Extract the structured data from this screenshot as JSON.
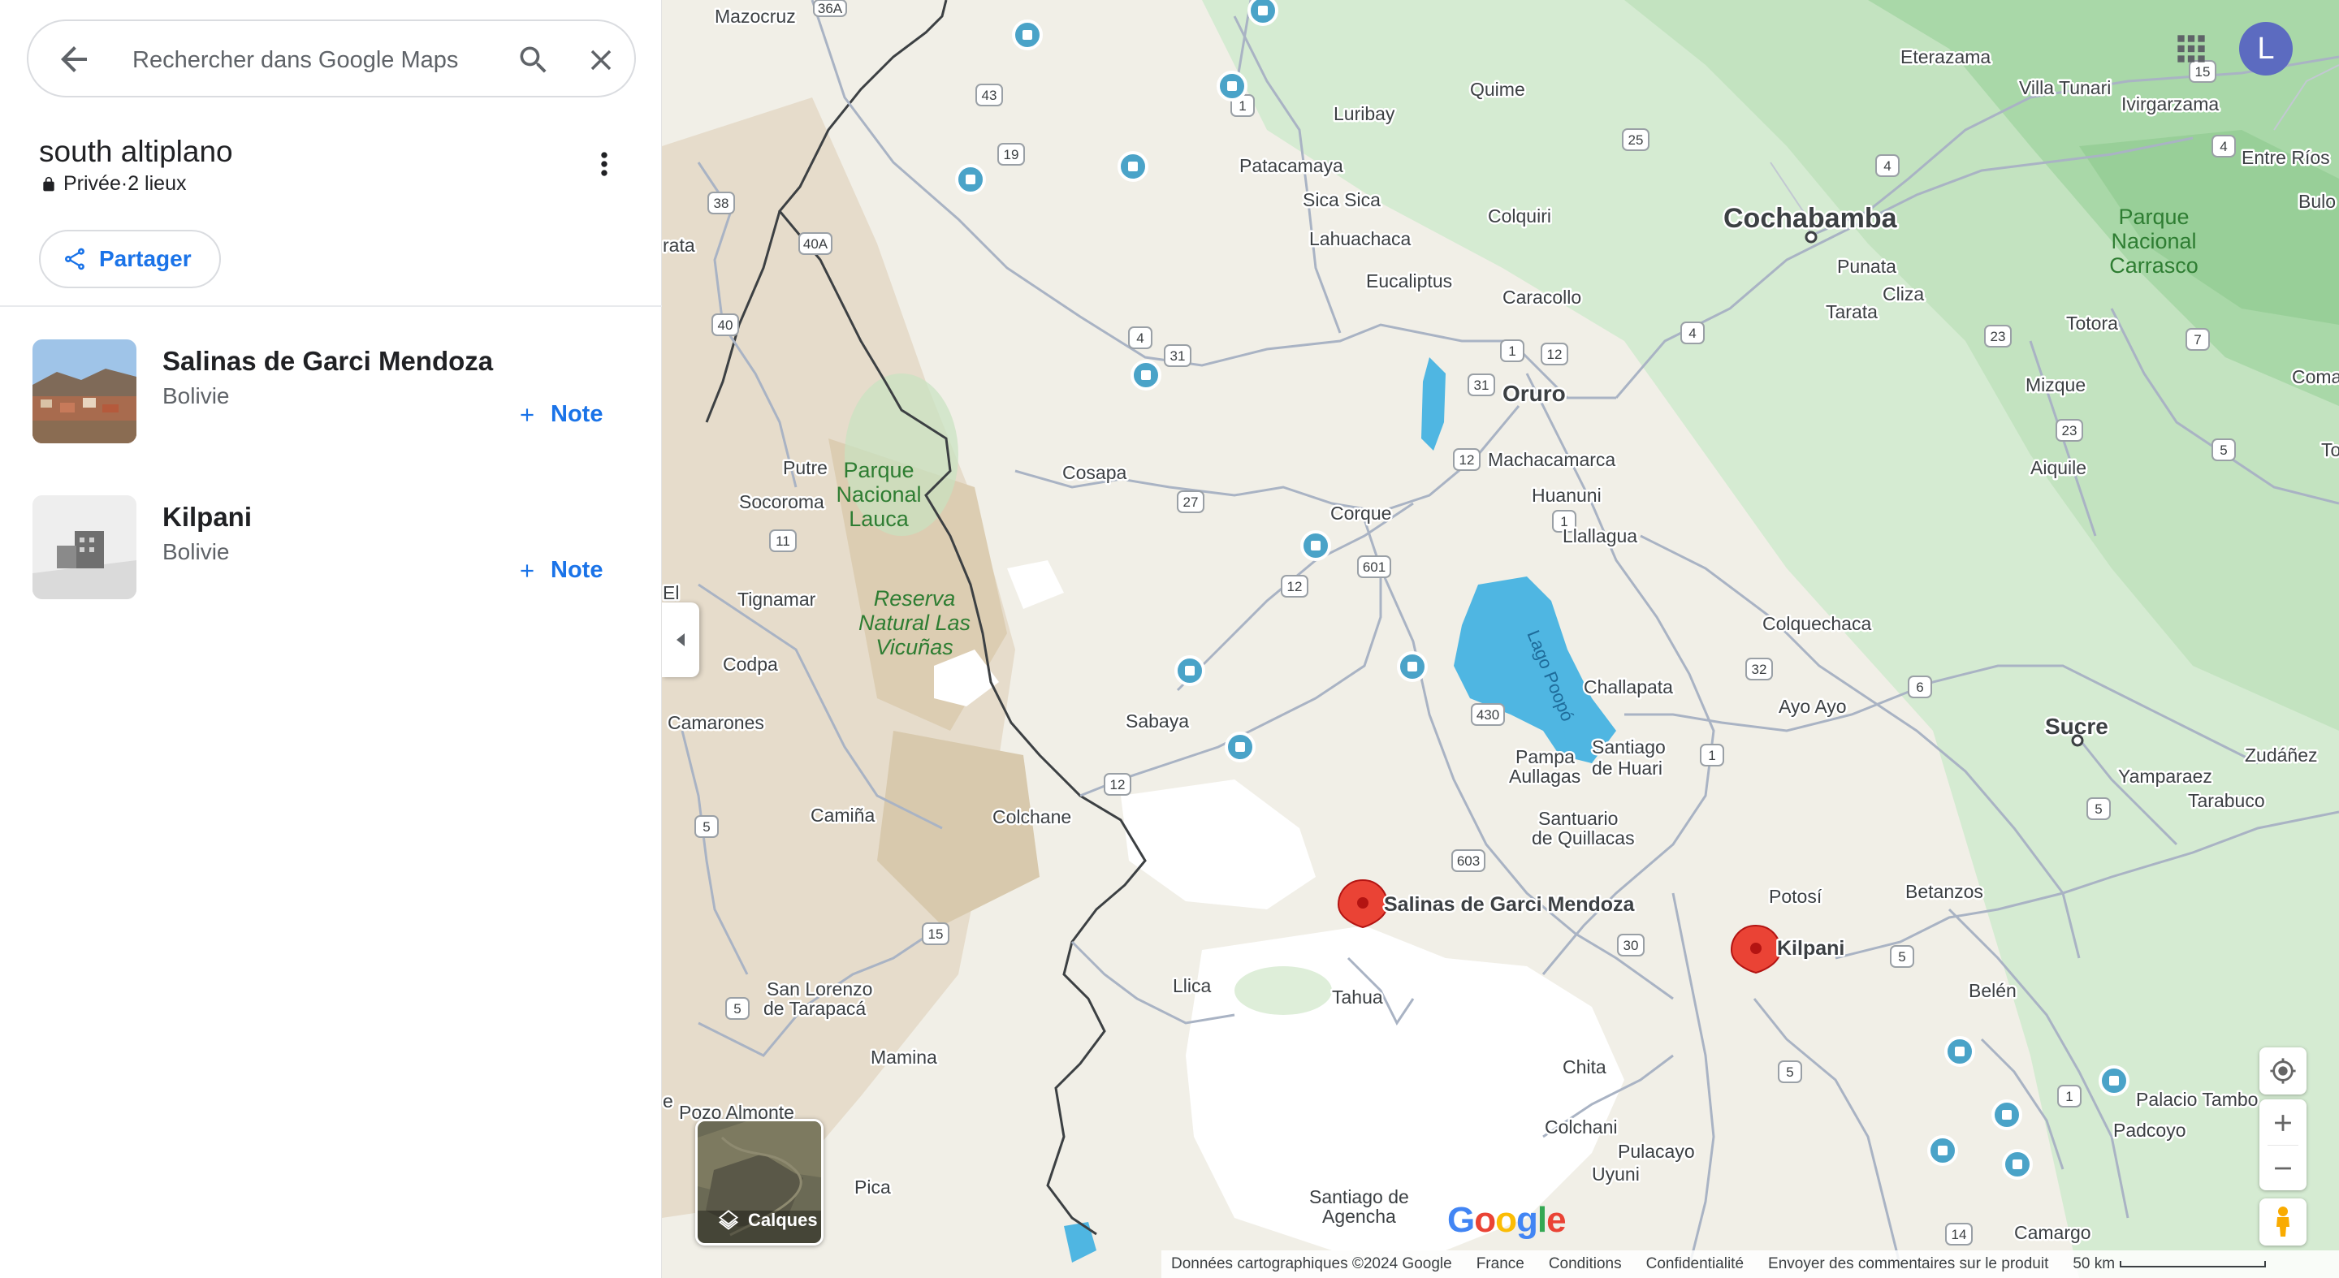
{
  "search": {
    "placeholder": "Rechercher dans Google Maps"
  },
  "list": {
    "title": "south altiplano",
    "privacy": "Privée",
    "separator": "·",
    "count": "2 lieux",
    "share_label": "Partager"
  },
  "places": [
    {
      "name": "Salinas de Garci Mendoza",
      "country": "Bolivie",
      "note_label": "Note"
    },
    {
      "name": "Kilpani",
      "country": "Bolivie",
      "note_label": "Note"
    }
  ],
  "map": {
    "user_initial": "L",
    "layers_label": "Calques",
    "logo": "Google",
    "footer": {
      "data": "Données cartographiques ©2024 Google",
      "country": "France",
      "terms": "Conditions",
      "privacy": "Confidentialité",
      "feedback": "Envoyer des commentaires sur le produit",
      "scale": "50 km"
    },
    "pins": [
      "Salinas de Garci Mendoza",
      "Kilpani"
    ],
    "city_labels": {
      "cochabamba": "Cochabamba",
      "oruro": "Oruro",
      "sucre": "Sucre"
    },
    "park_labels": {
      "lauca": [
        "Parque",
        "Nacional",
        "Lauca"
      ],
      "vicunas": [
        "Reserva",
        "Natural Las",
        "Vicuñas"
      ],
      "carrasco": [
        "Parque",
        "Nacional",
        "Carrasco"
      ],
      "lake": "Lago Poopó"
    },
    "town_labels": [
      "Mazocruz",
      "Quime",
      "Eterazama",
      "Villa Tunari",
      "Ivirgarzama",
      "Entre Ríos",
      "Bulo",
      "Luribay",
      "Patacamaya",
      "Sica Sica",
      "Lahuachaca",
      "Colquiri",
      "Eucaliptus",
      "Caracollo",
      "Punata",
      "Cliza",
      "Tarata",
      "Totora",
      "Mizque",
      "Comarapa",
      "Toro",
      "Aiquile",
      "Putre",
      "Socoroma",
      "Cosapa",
      "Machacamarca",
      "Huanuni",
      "Llallagua",
      "Corque",
      "Tignamar",
      "Codpa",
      "Camarones",
      "Sabaya",
      "Colquechaca",
      "Challapata",
      "Ayo Ayo",
      "Santiago",
      "de Huari",
      "Pampa",
      "Aullagas",
      "Santuario",
      "de Quillacas",
      "Yamparaez",
      "Tarabuco",
      "Zudáñez",
      "Camiña",
      "Colchane",
      "Potosí",
      "Betanzos",
      "Llica",
      "Tahua",
      "San Lorenzo",
      "de Tarapacá",
      "Belén",
      "Mamina",
      "Chita",
      "Colchani",
      "Pulacayo",
      "Uyuni",
      "Palacio Tambo",
      "Padcoyo",
      "Pica",
      "Santiago de",
      "Agencha",
      "Camargo",
      "Pozo Almonte",
      "El",
      "rata",
      "e"
    ],
    "road_numbers": [
      "36A",
      "43",
      "19",
      "1",
      "25",
      "4",
      "38",
      "40A",
      "40",
      "31",
      "4",
      "1",
      "12",
      "31",
      "12",
      "27",
      "601",
      "12",
      "1",
      "23",
      "7",
      "23",
      "5",
      "11",
      "430",
      "32",
      "6",
      "1",
      "5",
      "12",
      "5",
      "603",
      "15",
      "30",
      "5",
      "5",
      "5",
      "1",
      "14",
      "4",
      "15"
    ]
  },
  "colors": {
    "accent": "#1a73e8",
    "pin": "#ea4335",
    "poi": "#4aa3c8",
    "avatar": "#5c6bc0"
  },
  "icons": [
    "back-arrow-icon",
    "search-icon",
    "close-icon",
    "lock-icon",
    "more-vert-icon",
    "share-icon",
    "plus-icon",
    "collapse-chevron-icon",
    "apps-grid-icon",
    "layers-icon",
    "my-location-icon",
    "zoom-in-icon",
    "zoom-out-icon",
    "pegman-icon",
    "map-pin-icon",
    "poi-marker-icon"
  ]
}
